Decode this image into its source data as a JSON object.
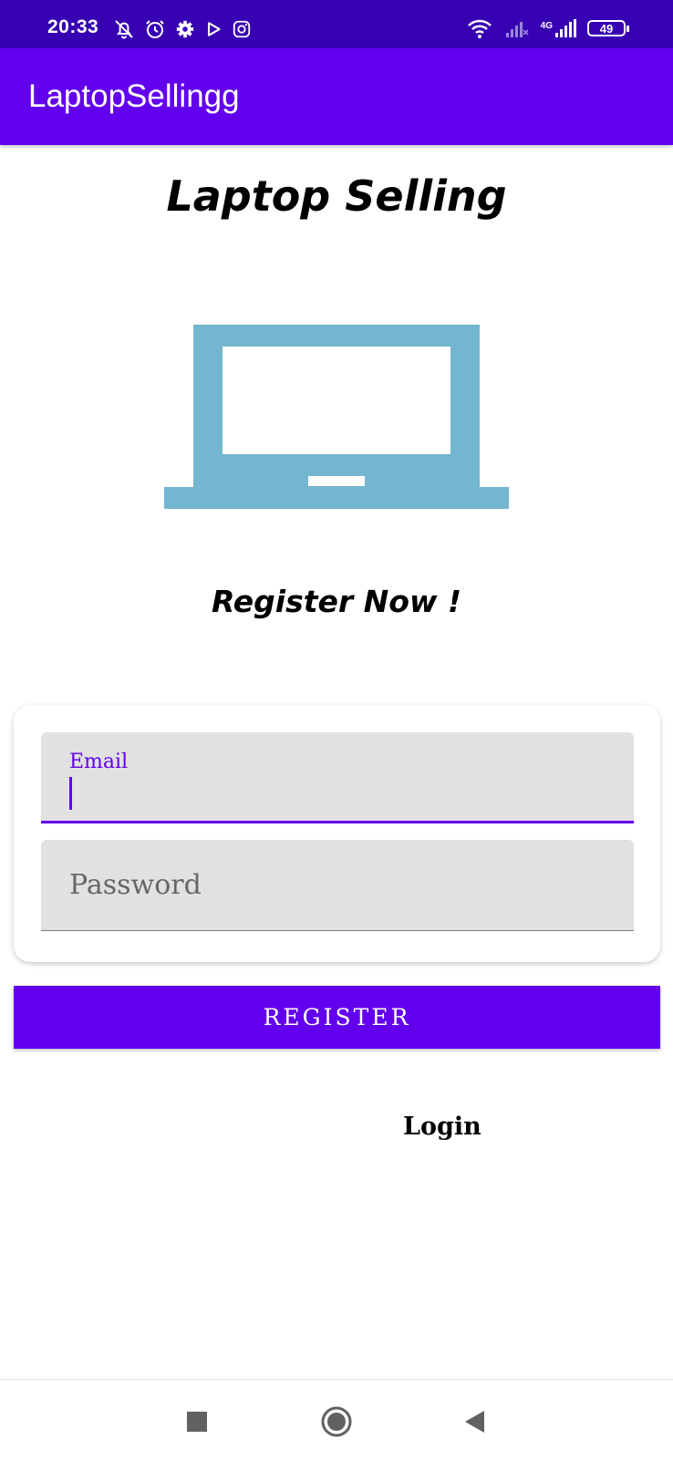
{
  "status_bar": {
    "time": "20:33",
    "battery": "49",
    "network_label": "4G"
  },
  "app_bar": {
    "title": "LaptopSellingg"
  },
  "hero": {
    "title": "Laptop Selling",
    "subtitle": "Register Now !",
    "image_icon": "laptop-icon",
    "image_color": "#74b6d0"
  },
  "form": {
    "email_label": "Email",
    "email_value": "",
    "password_placeholder": "Password"
  },
  "register_button": {
    "label": "REGISTER"
  },
  "login_link": {
    "label": "Login"
  },
  "colors": {
    "primary": "#6200ee",
    "primary_dark": "#3700b3",
    "field_bg": "#e1e1e1"
  },
  "nav": {
    "icons": [
      "recents-square-icon",
      "home-circle-icon",
      "back-triangle-icon"
    ]
  }
}
